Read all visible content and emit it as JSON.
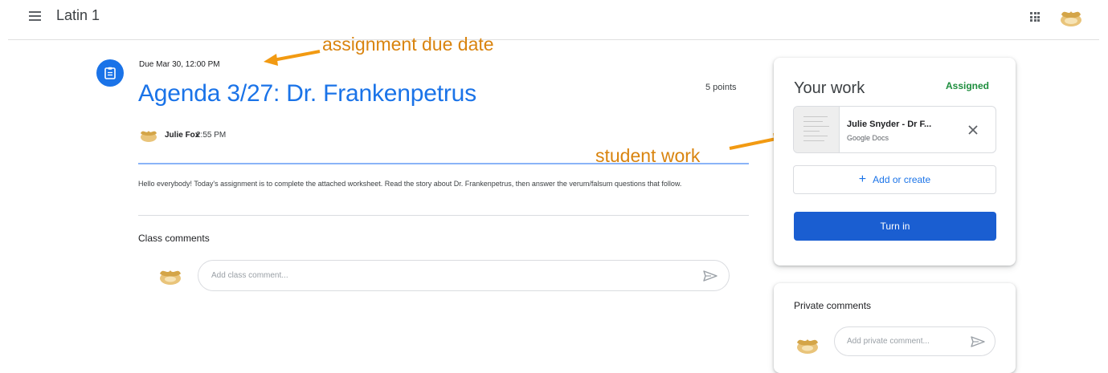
{
  "app": {
    "title": "Latin 1"
  },
  "assignment": {
    "due": "Due Mar 30, 12:00 PM",
    "title": "Agenda 3/27: Dr. Frankenpetrus",
    "points": "5 points",
    "author": "Julie Fox",
    "time": "2:55 PM",
    "description": "Hello everybody! Today's assignment is to complete the attached worksheet. Read the story about Dr. Frankenpetrus, then answer the verum/falsum questions that follow."
  },
  "class_comments": {
    "heading": "Class comments",
    "placeholder": "Add class comment..."
  },
  "annotations": {
    "due_label": "assignment due date",
    "work_label": "student work"
  },
  "your_work": {
    "title": "Your work",
    "status": "Assigned",
    "attachment": {
      "name": "Julie Snyder - Dr F...",
      "type": "Google Docs"
    },
    "add_label": "Add or create",
    "turn_in_label": "Turn in"
  },
  "private_comments": {
    "heading": "Private comments",
    "placeholder": "Add private comment..."
  },
  "colors": {
    "accent": "#1a73e8",
    "status_green": "#1e8e3e",
    "annotation_orange": "#d9840f",
    "button_blue": "#1a5ed1"
  },
  "icons": [
    "menu-icon",
    "apps-grid-icon",
    "assignment-icon",
    "close-icon",
    "plus-icon",
    "send-icon",
    "avatar"
  ]
}
